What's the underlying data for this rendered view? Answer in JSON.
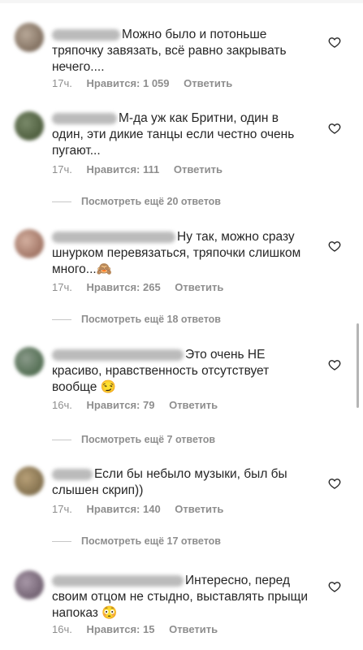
{
  "comments": [
    {
      "username": "",
      "text": "Можно было и потоньше тряпочку завязать, всё равно закрывать нечего....",
      "time": "17ч.",
      "likes": "Нравится: 1 059",
      "reply": "Ответить",
      "avatar_color": "#8a7a6a"
    },
    {
      "username": "",
      "text": "М-да уж как Бритни, один в один, эти дикие танцы если честно очень пугают...",
      "time": "17ч.",
      "likes": "Нравится: 111",
      "reply": "Ответить",
      "avatar_color": "#5a6a4a",
      "more": "Посмотреть ещё 20 ответов"
    },
    {
      "username": "",
      "text": "Ну так, можно сразу шнурком перевязаться, тряпочки слишком много...🙈",
      "time": "17ч.",
      "likes": "Нравится: 265",
      "reply": "Ответить",
      "avatar_color": "#9a7a6a",
      "more": "Посмотреть ещё 18 ответов"
    },
    {
      "username": "",
      "text": "Это очень НЕ красиво, нравственность отсутствует вообще 😏",
      "time": "16ч.",
      "likes": "Нравится: 79",
      "reply": "Ответить",
      "avatar_color": "#6a7a6a",
      "more": "Посмотреть ещё 7 ответов"
    },
    {
      "username": "",
      "text": "Если бы небыло музыки, был бы слышен скрип))",
      "time": "17ч.",
      "likes": "Нравится: 140",
      "reply": "Ответить",
      "avatar_color": "#8a7a5a",
      "more": "Посмотреть ещё 17 ответов"
    },
    {
      "username": "",
      "text": "Интересно, перед своим отцом не стыдно, выставлять прыщи напоказ 😳",
      "time": "16ч.",
      "likes": "Нравится: 15",
      "reply": "Ответить",
      "avatar_color": "#7a6a7a"
    }
  ],
  "icons": {
    "heart": "heart-outline-icon"
  },
  "colors": {
    "secondary_text": "#8e8e8e",
    "primary_text": "#262626"
  }
}
